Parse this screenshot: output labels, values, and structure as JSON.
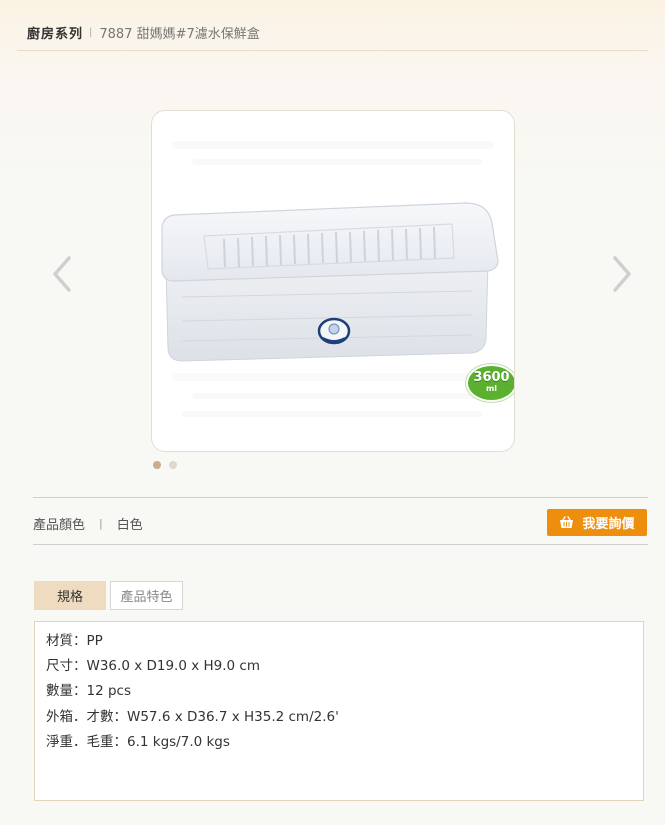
{
  "breadcrumb": {
    "category": "廚房系列",
    "separator": "|",
    "current": "7887 甜媽媽#7濾水保鮮盒"
  },
  "product_image": {
    "capacity_badge_value": "3600",
    "capacity_badge_unit": "ml",
    "icon_prev": "chevron-left-icon",
    "icon_next": "chevron-right-icon",
    "slide_count": 2,
    "active_slide": 1
  },
  "color": {
    "label": "產品顏色",
    "separator": "|",
    "value": "白色"
  },
  "inquiry_button": {
    "label": "我要詢價",
    "icon": "basket-icon",
    "color": "#ee8e0d"
  },
  "tabs": [
    {
      "label": "規格",
      "active": true
    },
    {
      "label": "產品特色",
      "active": false
    }
  ],
  "specs": [
    "材質：PP",
    "尺寸：W36.0 x D19.0 x H9.0 cm",
    "數量：12 pcs",
    "外箱．才數：W57.6 x D36.7 x H35.2 cm/2.6'",
    "淨重．毛重：6.1 kgs/7.0 kgs"
  ],
  "colors": {
    "accent": "#ee8e0d",
    "tab_active_bg": "#efdcc0",
    "badge_green": "#5bb030"
  }
}
